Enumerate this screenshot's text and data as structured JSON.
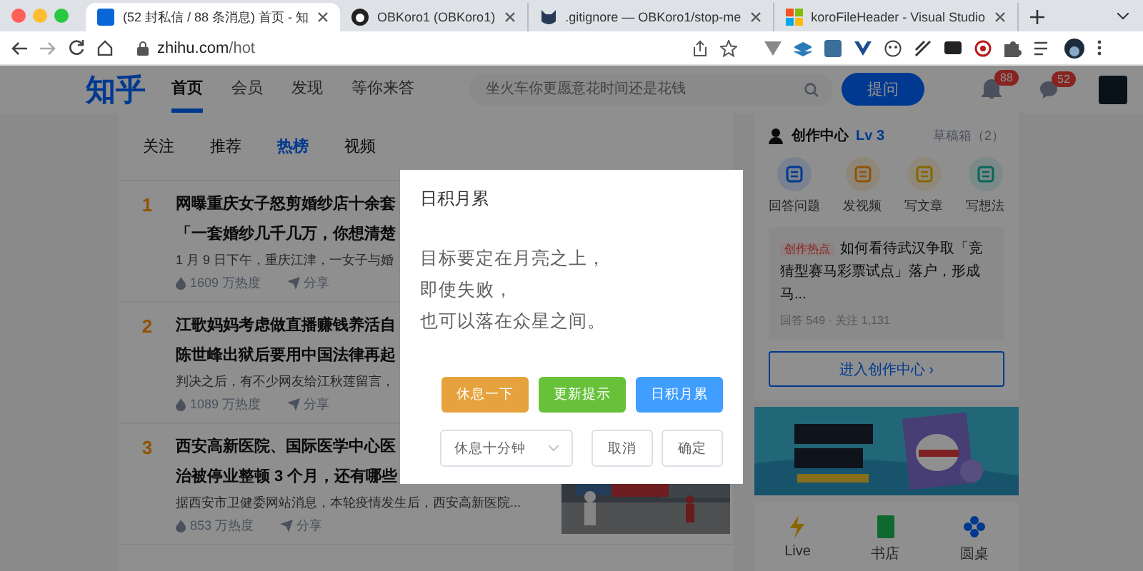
{
  "browser": {
    "tabs": [
      {
        "title": "(52 封私信 / 88 条消息) 首页 - 知",
        "selected": true,
        "kind": "zhihu"
      },
      {
        "title": "OBKoro1 (OBKoro1)",
        "selected": false,
        "kind": "github"
      },
      {
        "title": ".gitignore — OBKoro1/stop-me",
        "selected": false,
        "kind": "cat"
      },
      {
        "title": "koroFileHeader - Visual Studio",
        "selected": false,
        "kind": "windows"
      }
    ],
    "url_host": "zhihu.com",
    "url_path": "/hot"
  },
  "header": {
    "logo": "知乎",
    "nav": [
      {
        "label": "首页",
        "selected": true
      },
      {
        "label": "会员",
        "selected": false
      },
      {
        "label": "发现",
        "selected": false
      },
      {
        "label": "等你来答",
        "selected": false
      }
    ],
    "search": {
      "placeholder": "坐火车你更愿意花时间还是花钱"
    },
    "ask_button": "提问",
    "notifications_badge": "88",
    "messages_badge": "52"
  },
  "feed_tabs": [
    {
      "label": "关注",
      "selected": false
    },
    {
      "label": "推荐",
      "selected": false
    },
    {
      "label": "热榜",
      "selected": true
    },
    {
      "label": "视频",
      "selected": false
    }
  ],
  "hot_list": [
    {
      "rank": "1",
      "title_lines": [
        "网曝重庆女子怒剪婚纱店十余套",
        "「一套婚纱几千几万，你想清楚"
      ],
      "excerpt": "1 月 9 日下午，重庆江津，一女子与婚",
      "heat": "1609 万热度",
      "share": "分享"
    },
    {
      "rank": "2",
      "title_lines": [
        "江歌妈妈考虑做直播赚钱养活自",
        "陈世峰出狱后要用中国法律再起"
      ],
      "excerpt": "判决之后，有不少网友给江秋莲留言，",
      "heat": "1089 万热度",
      "share": "分享"
    },
    {
      "rank": "3",
      "title_lines": [
        "西安高新医院、国际医学中心医",
        "治被停业整顿 3 个月，还有哪些"
      ],
      "excerpt": "据西安市卫健委网站消息，本轮疫情发生后，西安高新医院...",
      "heat": "853 万热度",
      "share": "分享",
      "thumbnail": {
        "kind": "picture"
      }
    }
  ],
  "creator_card": {
    "title": "创作中心",
    "level": "Lv 3",
    "drafts": "草稿箱（2）",
    "actions": [
      {
        "label": "回答问题",
        "kind": "answer"
      },
      {
        "label": "发视频",
        "kind": "video"
      },
      {
        "label": "写文章",
        "kind": "article"
      },
      {
        "label": "写想法",
        "kind": "idea"
      }
    ],
    "hot_topic": {
      "tag": "创作热点",
      "text": "如何看待武汉争取「竞猜型赛马彩票试点」落户，形成马...",
      "stats": "回答 549 · 关注 1,131"
    },
    "enter_button": "进入创作中心 ›"
  },
  "banner": {
    "kind": "picture"
  },
  "shortcuts": [
    {
      "label": "Live",
      "kind": "live"
    },
    {
      "label": "书店",
      "kind": "book"
    },
    {
      "label": "圆桌",
      "kind": "table"
    }
  ],
  "dialog": {
    "title": "日积月累",
    "message_lines": [
      "目标要定在月亮之上，",
      "即使失败，",
      "也可以落在众星之间。"
    ],
    "buttons": [
      {
        "label": "休息一下",
        "kind": "warning"
      },
      {
        "label": "更新提示",
        "kind": "success"
      },
      {
        "label": "日积月累",
        "kind": "primary"
      }
    ],
    "select": {
      "value": "休息十分钟"
    },
    "cancel": "取消",
    "confirm": "确定"
  }
}
